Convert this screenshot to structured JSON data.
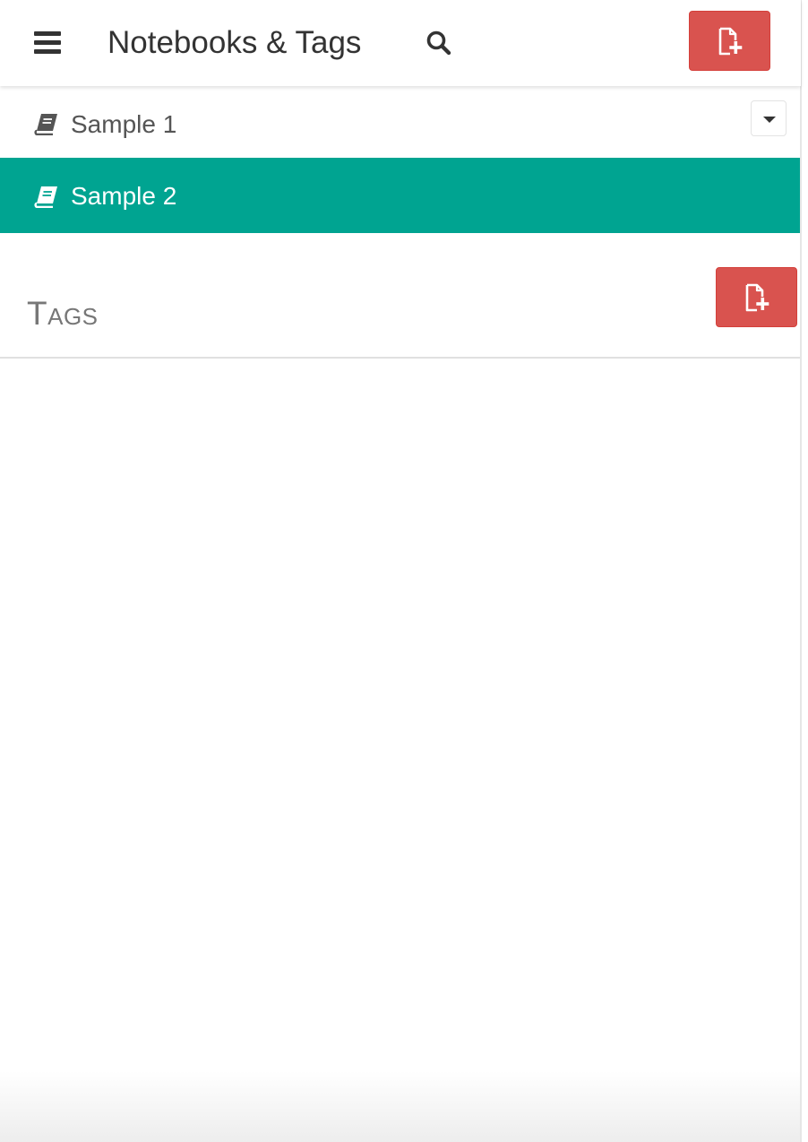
{
  "header": {
    "title": "Notebooks & Tags",
    "menu_icon": "hamburger-menu-icon",
    "search_icon": "search-icon",
    "new_icon": "file-add-icon"
  },
  "notebooks": [
    {
      "label": "Sample 1",
      "icon": "book-icon",
      "selected": false
    },
    {
      "label": "Sample 2",
      "icon": "book-icon",
      "selected": true
    }
  ],
  "tags": {
    "title": "Tags",
    "new_icon": "file-add-icon"
  },
  "colors": {
    "accent": "#00a491",
    "danger": "#d9534f",
    "text": "#333333",
    "muted": "#777777"
  }
}
